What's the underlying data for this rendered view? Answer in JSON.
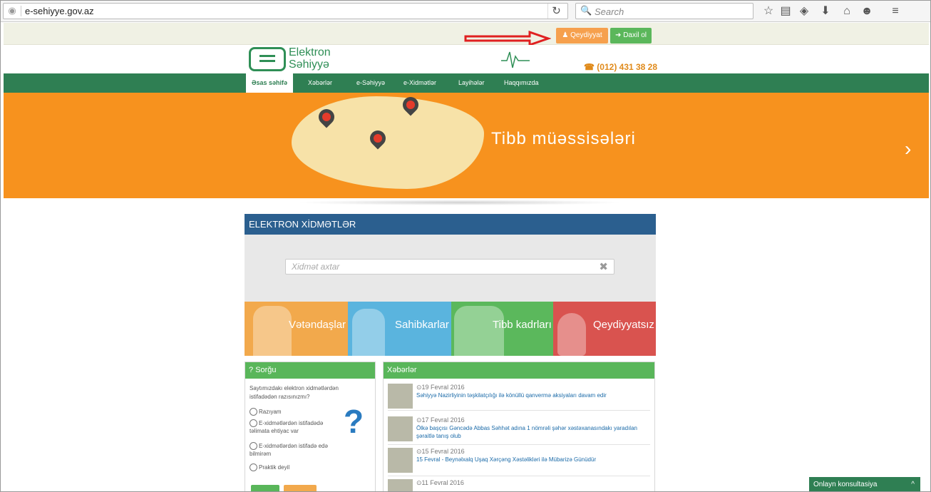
{
  "browser": {
    "url": "e-sehiyye.gov.az",
    "search_placeholder": "Search"
  },
  "topbar": {
    "register_label": "Qeydiyyat",
    "login_label": "Daxil ol"
  },
  "header": {
    "logo_line1": "Elektron",
    "logo_line2": "Səhiyyə",
    "phone": "(012) 431 38 28"
  },
  "nav": {
    "items": [
      "Əsas səhifə",
      "Xəbərlər",
      "e-Səhiyyə",
      "e-Xidmətlər",
      "Layihələr",
      "Haqqımızda"
    ]
  },
  "banner": {
    "title": "Tibb  müəssisələri"
  },
  "services": {
    "title": "ELEKTRON XİDMƏTLƏR",
    "search_placeholder": "Xidmət axtar",
    "tiles": [
      {
        "label": "Vətəndaşlar",
        "color": "#f2a94c"
      },
      {
        "label": "Sahibkarlar",
        "color": "#5ab4de"
      },
      {
        "label": "Tibb kadrları",
        "color": "#5bb85c"
      },
      {
        "label": "Qeydiyyatsız",
        "color": "#d9534f"
      }
    ]
  },
  "survey": {
    "title": "Sorğu",
    "question": "Saytımızdakı elektron xidmətlərdən istifadədən razısınızmı?",
    "options": [
      "Razıyam",
      "E-xidmətlərdən istifadədə təlimata ehtiyac var",
      "E-xidmətlərdən istifadə edə bilmirəm",
      "Praktik deyil"
    ]
  },
  "news": {
    "title": "Xəbərlər",
    "items": [
      {
        "date": "19 Fevral 2016",
        "title": "Səhiyyə Nazirliyinin təşkilatçılığı ilə könüllü qanvermə aksiyaları davam edir"
      },
      {
        "date": "17 Fevral 2016",
        "title": "Ölkə başçısı Gəncədə Abbas Səhhət adına 1 nömrəli şəhər xəstəxanasındakı yaradılan şəraitlə tanış olub"
      },
      {
        "date": "15 Fevral 2016",
        "title": "15 Fevral - Beynəlxalq Uşaq Xərçəng Xəstəlikləri ilə Mübarizə Günüdür"
      },
      {
        "date": "11 Fevral 2016",
        "title": ""
      }
    ]
  },
  "chat": {
    "label": "Onlayn konsultasiya"
  },
  "colors": {
    "green": "#2f7f53",
    "orange": "#f7921e",
    "blue_header": "#2b5f8f"
  }
}
